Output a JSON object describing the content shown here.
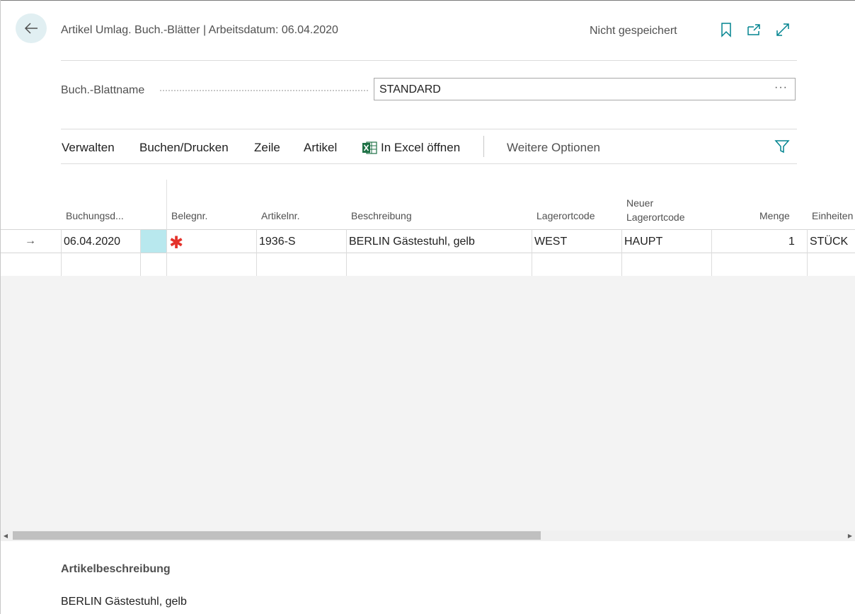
{
  "header": {
    "title": "Artikel Umlag. Buch.-Blätter | Arbeitsdatum: 06.04.2020",
    "status": "Nicht gespeichert",
    "accent_color": "#00838f"
  },
  "field": {
    "label": "Buch.-Blattname",
    "value": "STANDARD",
    "more": "···"
  },
  "actions": {
    "items": [
      "Verwalten",
      "Buchen/Drucken",
      "Zeile",
      "Artikel",
      "In Excel öffnen"
    ],
    "more": "Weitere Optionen"
  },
  "grid": {
    "columns": {
      "buchungsdatum": "Buchungsd...",
      "belegnr": "Belegnr.",
      "artikelnr": "Artikelnr.",
      "beschreibung": "Beschreibung",
      "lagerort": "Lagerortcode",
      "neuer_line1": "Neuer",
      "neuer_line2": "Lagerortcode",
      "menge": "Menge",
      "einheiten": "Einheiten"
    },
    "rows": [
      {
        "indicator": "→",
        "buchungsdatum": "06.04.2020",
        "belegnr_marker": "✱",
        "artikelnr": "1936-S",
        "beschreibung": "BERLIN Gästestuhl, gelb",
        "lagerort": "WEST",
        "neuer_lagerort": "HAUPT",
        "menge": "1",
        "einheiten": "STÜCK"
      }
    ]
  },
  "factbox": {
    "title": "Artikelbeschreibung",
    "value": "BERLIN Gästestuhl, gelb"
  }
}
